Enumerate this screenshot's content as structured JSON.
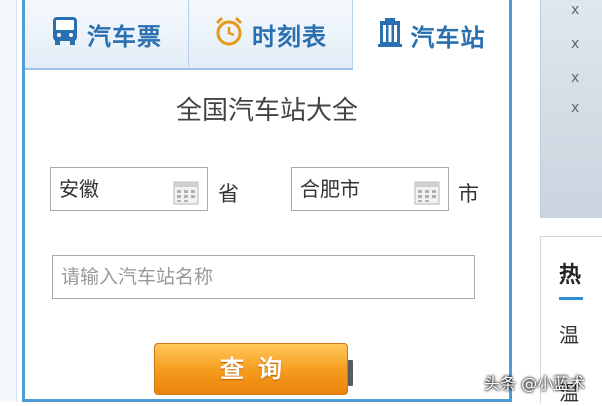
{
  "tabs": [
    {
      "label": "汽车票",
      "icon": "bus-icon",
      "active": false
    },
    {
      "label": "时刻表",
      "icon": "alarm-clock-icon",
      "active": false
    },
    {
      "label": "汽车站",
      "icon": "building-icon",
      "active": true
    }
  ],
  "main": {
    "title": "全国汽车站大全",
    "province": {
      "value": "安徽",
      "unit": "省",
      "icon": "calendar-icon"
    },
    "city": {
      "value": "合肥市",
      "unit": "市",
      "icon": "calendar-icon"
    },
    "station": {
      "placeholder": "请输入汽车站名称"
    },
    "search_label": "查询"
  },
  "background_page": {
    "heading": "热",
    "items": [
      "温",
      "温"
    ],
    "close_marks": [
      "x",
      "x",
      "x",
      "x"
    ]
  },
  "watermark": "头条 @小蓝术",
  "colors": {
    "tab_text": "#2a6fb0",
    "border_blue": "#4f9dd6",
    "button_orange": "#f59a1b",
    "accent_blue": "#2a8fd6"
  }
}
